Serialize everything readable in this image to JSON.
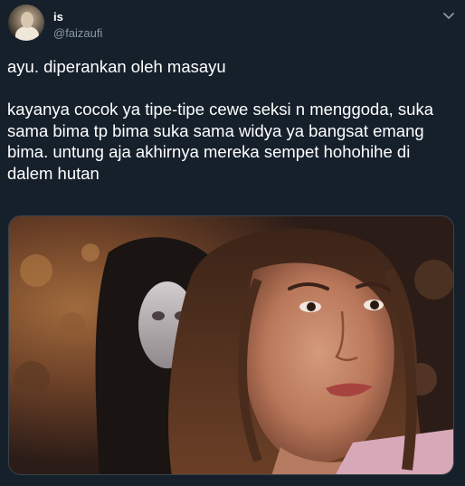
{
  "author": {
    "display_name": "is",
    "handle": "@faizaufi",
    "avatar_icon": "user-avatar"
  },
  "menu": {
    "icon": "chevron-down-icon"
  },
  "tweet": {
    "paragraph1": "ayu. diperankan oleh masayu",
    "paragraph2": "kayanya cocok ya tipe-tipe cewe seksi n menggoda, suka sama bima tp bima suka sama widya ya bangsat emang bima. untung aja akhirnya mereka sempet hohohihe di dalem hutan"
  },
  "colors": {
    "background": "#15202b",
    "primary_text": "#ffffff",
    "secondary_text": "#8899a6",
    "border": "#38444d"
  }
}
